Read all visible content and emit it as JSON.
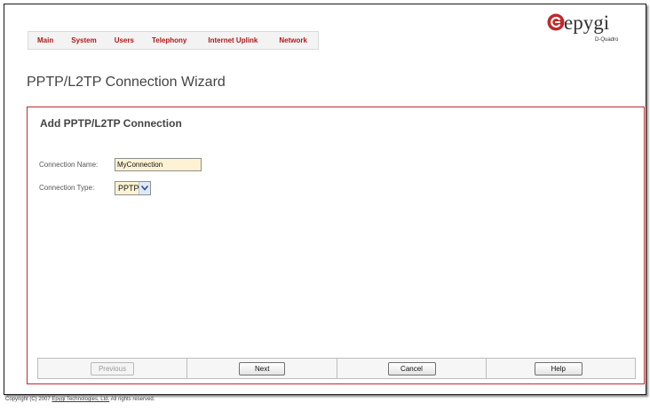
{
  "nav": {
    "items": [
      "Main",
      "System",
      "Users",
      "Telephony",
      "Internet Uplink",
      "Network"
    ]
  },
  "brand": {
    "logo_text": "epygi",
    "product": "D-Quadro",
    "logo_color": "#c0282a"
  },
  "page": {
    "title": "PPTP/L2TP Connection Wizard"
  },
  "panel": {
    "title": "Add PPTP/L2TP Connection",
    "border_color": "#c22a2a"
  },
  "form": {
    "connection_name_label": "Connection Name:",
    "connection_name_value": "MyConnection",
    "connection_type_label": "Connection Type:",
    "connection_type_value": "PPTP"
  },
  "buttons": {
    "previous": "Previous",
    "next": "Next",
    "cancel": "Cancel",
    "help": "Help"
  },
  "footer": {
    "prefix": "Copyright (C) 2007",
    "company": "Epygi Technologies, Ltd.",
    "suffix": "All rights reserved."
  },
  "icons": {
    "select_arrow": "chevron-down-icon",
    "logo_mark": "epygi-logo-icon"
  }
}
